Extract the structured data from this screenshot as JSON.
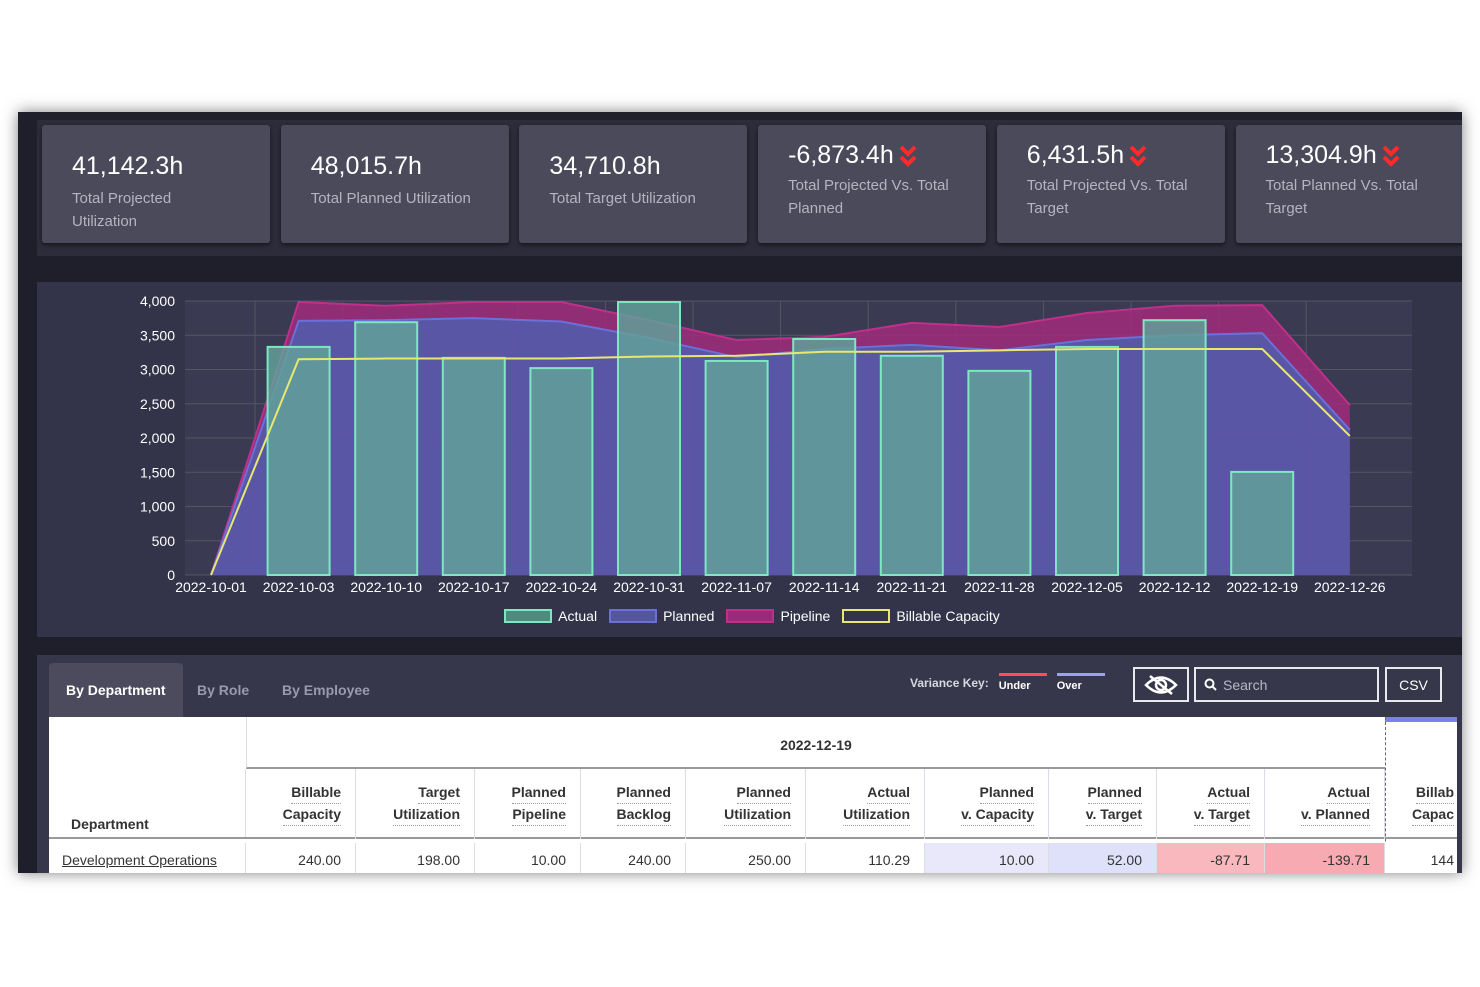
{
  "cards": [
    {
      "value": "41,142.3h",
      "label": "Total Projected Utilization",
      "arrow": false
    },
    {
      "value": "48,015.7h",
      "label": "Total Planned Utilization",
      "arrow": false
    },
    {
      "value": "34,710.8h",
      "label": "Total Target Utilization",
      "arrow": false
    },
    {
      "value": "-6,873.4h",
      "label": "Total Projected Vs. Total Planned",
      "arrow": true
    },
    {
      "value": "6,431.5h",
      "label": "Total Projected Vs. Total Target",
      "arrow": true
    },
    {
      "value": "13,304.9h",
      "label": "Total Planned Vs. Total Target",
      "arrow": true
    }
  ],
  "arrow_icon": "double-chevron-down-icon",
  "arrow_color": "#ff2a2a",
  "chart_data": {
    "type": "bar+area",
    "categories": [
      "2022-10-01",
      "2022-10-03",
      "2022-10-10",
      "2022-10-17",
      "2022-10-24",
      "2022-10-31",
      "2022-11-07",
      "2022-11-14",
      "2022-11-21",
      "2022-11-28",
      "2022-12-05",
      "2022-12-12",
      "2022-12-19",
      "2022-12-26"
    ],
    "ylim": [
      0,
      4000
    ],
    "yticks": [
      "0",
      "500",
      "1,000",
      "1,500",
      "2,000",
      "2,500",
      "3,000",
      "3,500",
      "4,000"
    ],
    "grid": true,
    "legend_placement": "bottom",
    "series": [
      {
        "name": "Actual",
        "type": "bar",
        "color": "#7de8c0",
        "values": [
          null,
          3330,
          3690,
          3170,
          3020,
          3985,
          3125,
          3445,
          3200,
          2980,
          3330,
          3720,
          1505,
          null
        ]
      },
      {
        "name": "Planned",
        "type": "area",
        "color": "#6a70d8",
        "values": [
          0,
          3710,
          3720,
          3750,
          3700,
          3460,
          3180,
          3300,
          3360,
          3280,
          3430,
          3500,
          3530,
          2120
        ]
      },
      {
        "name": "Pipeline",
        "type": "area",
        "color": "#c0308a",
        "values": [
          0,
          3985,
          3930,
          3985,
          3985,
          3720,
          3430,
          3475,
          3680,
          3620,
          3825,
          3930,
          3940,
          2480
        ]
      },
      {
        "name": "Billable Capacity",
        "type": "line",
        "color": "#e8e870",
        "values": [
          0,
          3150,
          3160,
          3160,
          3160,
          3190,
          3200,
          3260,
          3260,
          3280,
          3300,
          3300,
          3300,
          2030
        ]
      }
    ]
  },
  "tabs": [
    "By Department",
    "By Role",
    "By Employee"
  ],
  "variance_key": {
    "label": "Variance Key:",
    "under": "Under",
    "over": "Over",
    "under_color": "#ff4d5a",
    "over_color": "#9aa0ff"
  },
  "toolbar": {
    "hide_icon": "eye-slash-icon",
    "search_placeholder": "Search",
    "csv": "CSV"
  },
  "table": {
    "period": "2022-12-19",
    "first_header": "Department",
    "headers": [
      [
        "Billable",
        "Capacity"
      ],
      [
        "Target",
        "Utilization"
      ],
      [
        "Planned",
        "Pipeline"
      ],
      [
        "Planned",
        "Backlog"
      ],
      [
        "Planned",
        "Utilization"
      ],
      [
        "Actual",
        "Utilization"
      ],
      [
        "Planned",
        "v. Capacity"
      ],
      [
        "Planned",
        "v. Target"
      ],
      [
        "Actual",
        "v. Target"
      ],
      [
        "Actual",
        "v. Planned"
      ],
      [
        "Billab",
        "Capac"
      ]
    ],
    "rows": [
      {
        "name": "Development Operations",
        "cells": [
          "240.00",
          "198.00",
          "10.00",
          "240.00",
          "250.00",
          "110.29",
          "10.00",
          "52.00",
          "-87.71",
          "-139.71",
          "144"
        ]
      }
    ]
  }
}
